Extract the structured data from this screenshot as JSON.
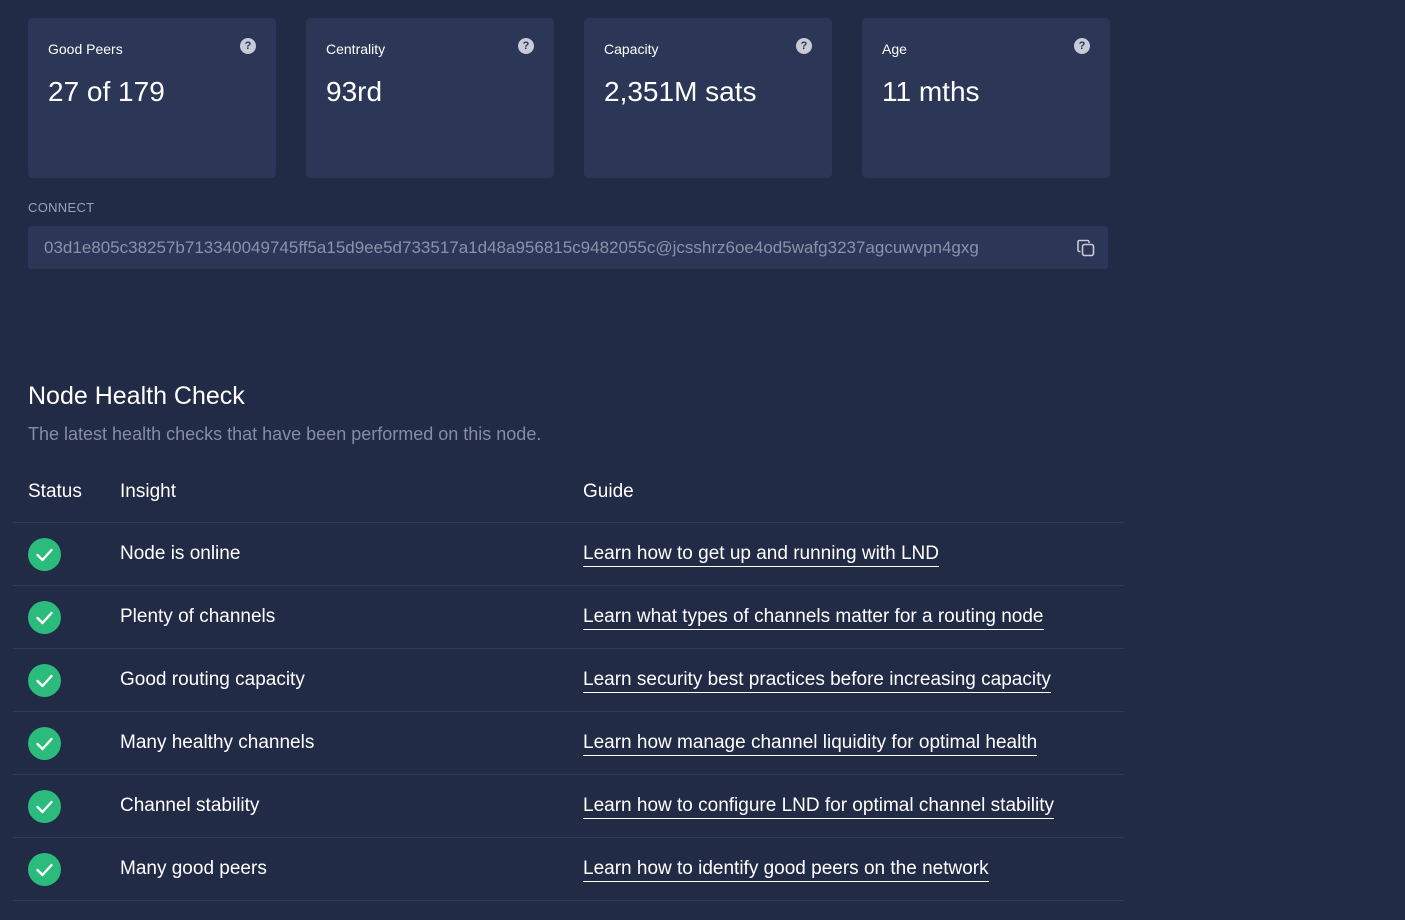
{
  "stats": [
    {
      "label": "Good Peers",
      "value": "27 of 179",
      "help": "?"
    },
    {
      "label": "Centrality",
      "value": "93rd",
      "help": "?"
    },
    {
      "label": "Capacity",
      "value": "2,351M sats",
      "help": "?"
    },
    {
      "label": "Age",
      "value": "11 mths",
      "help": "?"
    }
  ],
  "connect": {
    "label": "CONNECT",
    "value": "03d1e805c38257b713340049745ff5a15d9ee5d733517a1d48a956815c9482055c@jcsshrz6oe4od5wafg3237agcuwvpn4gxg"
  },
  "health": {
    "title": "Node Health Check",
    "subtitle": "The latest health checks that have been performed on this node.",
    "columns": {
      "status": "Status",
      "insight": "Insight",
      "guide": "Guide"
    },
    "rows": [
      {
        "status": "pass",
        "insight": "Node is online",
        "guide": "Learn how to get up and running with LND"
      },
      {
        "status": "pass",
        "insight": "Plenty of channels",
        "guide": "Learn what types of channels matter for a routing node"
      },
      {
        "status": "pass",
        "insight": "Good routing capacity",
        "guide": "Learn security best practices before increasing capacity"
      },
      {
        "status": "pass",
        "insight": "Many healthy channels",
        "guide": "Learn how manage channel liquidity for optimal health"
      },
      {
        "status": "pass",
        "insight": "Channel stability",
        "guide": "Learn how to configure LND for optimal channel stability"
      },
      {
        "status": "pass",
        "insight": "Many good peers",
        "guide": "Learn how to identify good peers on the network"
      }
    ]
  },
  "colors": {
    "background": "#222b45",
    "card": "#2c3758",
    "success": "#2bbb7c",
    "muted": "#848ca6"
  },
  "icons": {
    "help": "question-circle-icon",
    "copy": "copy-icon",
    "status_pass": "check-circle-icon"
  }
}
